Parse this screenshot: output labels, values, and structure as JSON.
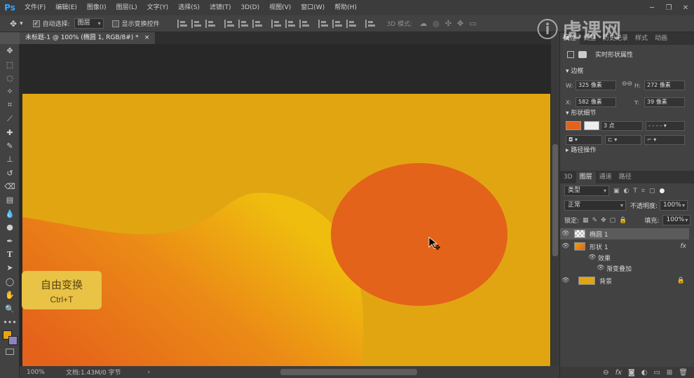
{
  "app": {
    "logo": "Ps"
  },
  "menu": [
    "文件(F)",
    "编辑(E)",
    "图像(I)",
    "图层(L)",
    "文字(Y)",
    "选择(S)",
    "滤镜(T)",
    "3D(D)",
    "视图(V)",
    "窗口(W)",
    "帮助(H)"
  ],
  "options": {
    "auto_select_label": "自动选择:",
    "auto_select_value": "图层",
    "show_transform_label": "显示变换控件",
    "mode_3d_label": "3D 模式:"
  },
  "document": {
    "tab_title": "未标题-1 @ 100% (椭圆 1, RGB/8#) *",
    "close": "×"
  },
  "status": {
    "zoom": "100%",
    "doc_info": "文档:1.43M/0 字节",
    "arrow": "›"
  },
  "hud": {
    "title": "自由变换",
    "shortcut": "Ctrl+T"
  },
  "watermark": {
    "text": "虎课网"
  },
  "properties": {
    "tabs": [
      "属性",
      "调整",
      "历史记录",
      "样式",
      "动画"
    ],
    "header": "实时形状属性",
    "bbox_section": "边框",
    "w_label": "W:",
    "w_value": "325 像素",
    "h_label": "H:",
    "h_value": "272 像素",
    "x_label": "X:",
    "x_value": "582 像素",
    "y_label": "Y:",
    "y_value": "39 像素",
    "shape_section": "形状细节",
    "stroke_width": "3 点",
    "path_section": "路径操作",
    "fill_color": "#e4631a"
  },
  "layers": {
    "tabs": [
      "3D",
      "图层",
      "通道",
      "路径"
    ],
    "filter_label": "类型",
    "blend_mode": "正常",
    "opacity_label": "不透明度:",
    "opacity_value": "100%",
    "lock_label": "锁定:",
    "fill_label": "填充:",
    "fill_value": "100%",
    "items": [
      {
        "name": "椭圆 1",
        "selected": true
      },
      {
        "name": "形状 1",
        "fx": "fx"
      },
      {
        "name": "效果"
      },
      {
        "name": "渐变叠加"
      },
      {
        "name": "背景"
      }
    ]
  },
  "colors": {
    "foreground": "#e8a411",
    "background": "#8d83c2",
    "doc_bg": "#e2a512",
    "ellipse": "#e4631a"
  }
}
